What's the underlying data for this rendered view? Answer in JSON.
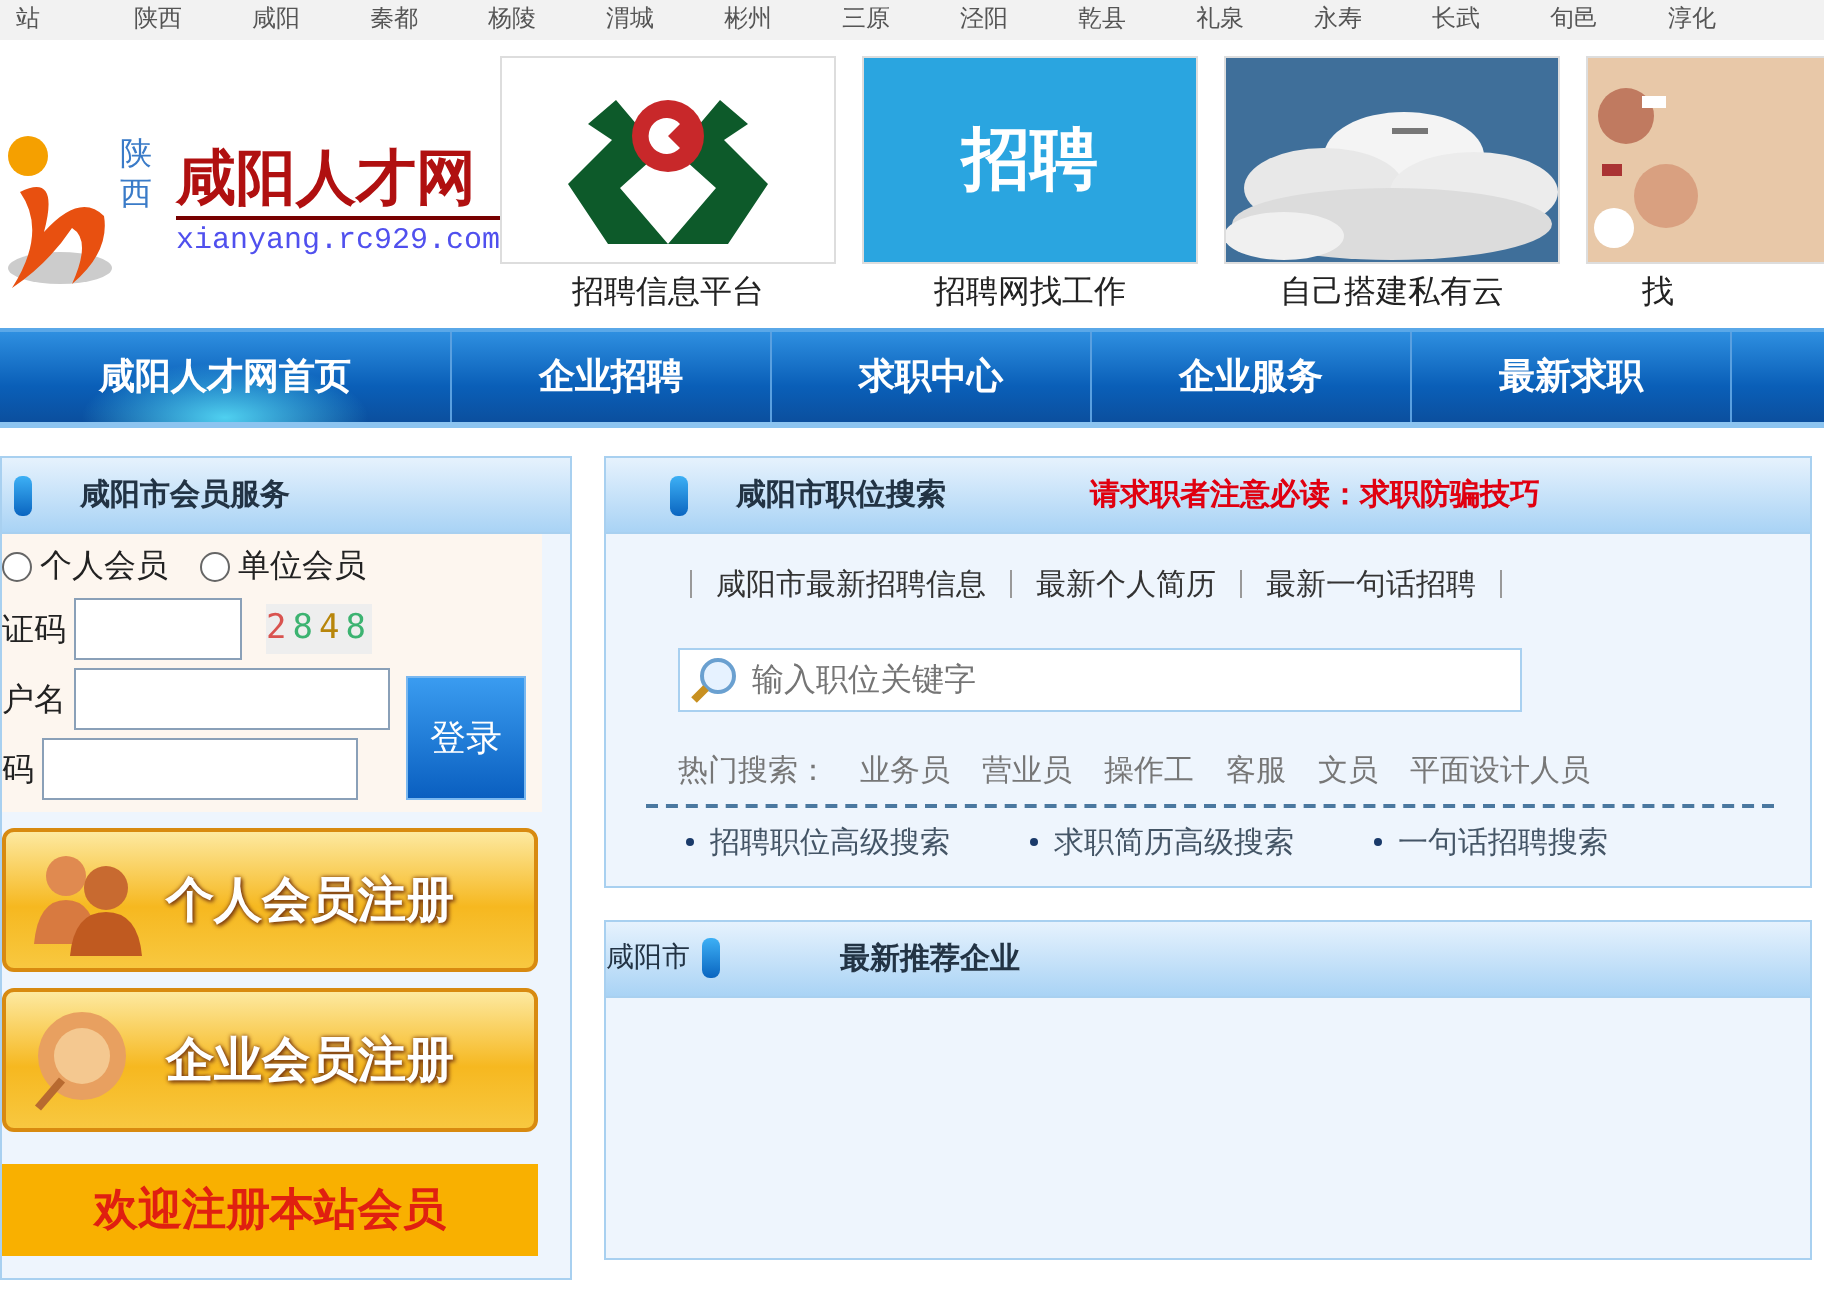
{
  "city_bar": [
    "站",
    "陕西",
    "咸阳",
    "秦都",
    "杨陵",
    "渭城",
    "彬州",
    "三原",
    "泾阳",
    "乾县",
    "礼泉",
    "永寿",
    "长武",
    "旬邑",
    "淳化"
  ],
  "logo": {
    "province": "陕西",
    "title": "咸阳人才网",
    "url": "xianyang.rc929.com"
  },
  "banners": [
    {
      "kind": "emblem",
      "caption": "招聘信息平台"
    },
    {
      "kind": "text",
      "text": "招聘",
      "caption": "招聘网找工作"
    },
    {
      "kind": "picture",
      "caption": "自己搭建私有云"
    },
    {
      "kind": "picture",
      "caption": "找"
    }
  ],
  "nav": [
    {
      "label": "咸阳人才网首页",
      "selected": true
    },
    {
      "label": "企业招聘",
      "selected": false
    },
    {
      "label": "求职中心",
      "selected": false
    },
    {
      "label": "企业服务",
      "selected": false
    },
    {
      "label": "最新求职",
      "selected": false
    }
  ],
  "member_panel": {
    "title": "咸阳市会员服务",
    "account_types": [
      {
        "label": "个人会员",
        "checked": false
      },
      {
        "label": "单位会员",
        "checked": false
      }
    ],
    "captcha_label": "证码",
    "captcha": [
      {
        "digit": "2",
        "color": "#d9534f"
      },
      {
        "digit": "8",
        "color": "#3cb371"
      },
      {
        "digit": "4",
        "color": "#b8860b"
      },
      {
        "digit": "8",
        "color": "#3cb371"
      }
    ],
    "username_label": "户名",
    "password_label": "码",
    "login_button": "登录",
    "register_buttons": [
      {
        "kind": "person",
        "label": "个人会员注册"
      },
      {
        "kind": "company",
        "label": "企业会员注册"
      }
    ],
    "welcome": "欢迎注册本站会员"
  },
  "search_panel": {
    "title": "咸阳市职位搜索",
    "notice": "请求职者注意必读：求职防骗技巧",
    "links": [
      "咸阳市最新招聘信息",
      "最新个人简历",
      "最新一句话招聘"
    ],
    "search": {
      "placeholder": "输入职位关键字"
    },
    "hot_label": "热门搜索：",
    "hot": [
      "业务员",
      "营业员",
      "操作工",
      "客服",
      "文员",
      "平面设计人员"
    ],
    "advanced": [
      "招聘职位高级搜索",
      "求职简历高级搜索",
      "一句话招聘搜索"
    ]
  },
  "companies_panel": {
    "prefix": "咸阳市",
    "title": "最新推荐企业"
  }
}
